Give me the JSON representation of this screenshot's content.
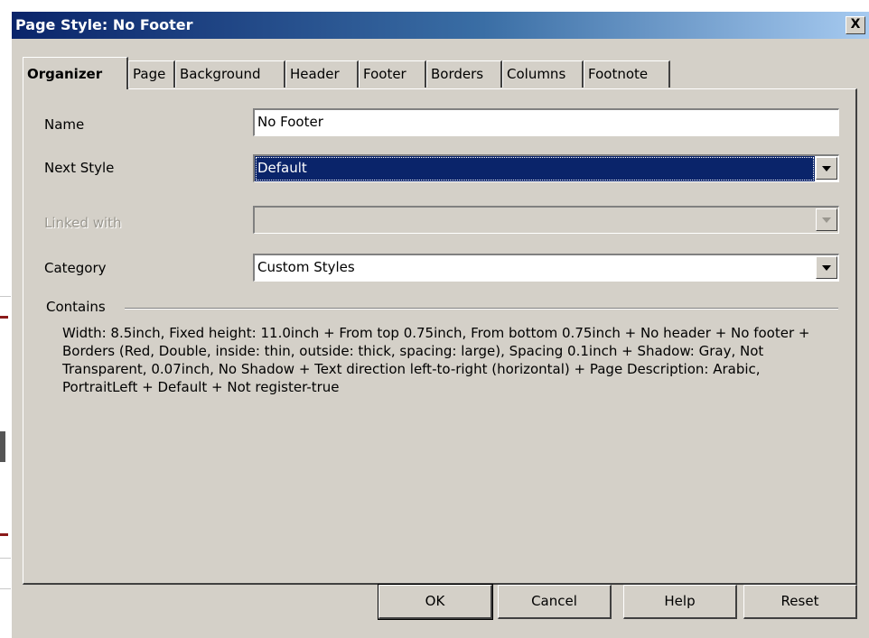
{
  "window": {
    "title": "Page Style: No Footer",
    "close_label": "X"
  },
  "tabs": [
    {
      "label": "Organizer",
      "active": true
    },
    {
      "label": "Page"
    },
    {
      "label": "Background"
    },
    {
      "label": "Header"
    },
    {
      "label": "Footer"
    },
    {
      "label": "Borders"
    },
    {
      "label": "Columns"
    },
    {
      "label": "Footnote"
    }
  ],
  "organizer": {
    "name": {
      "label": "Name",
      "value": "No Footer"
    },
    "next_style": {
      "label": "Next Style",
      "value": "Default"
    },
    "linked_with": {
      "label": "Linked with",
      "value": "",
      "disabled": true
    },
    "category": {
      "label": "Category",
      "value": "Custom Styles"
    },
    "contains": {
      "label": "Contains",
      "text": "Width: 8.5inch, Fixed height: 11.0inch + From top 0.75inch, From bottom 0.75inch + No header + No footer + Borders (Red, Double, inside: thin, outside: thick, spacing: large), Spacing 0.1inch + Shadow: Gray, Not Transparent, 0.07inch, No Shadow + Text direction left-to-right (horizontal) + Page Description: Arabic, PortraitLeft + Default + Not register-true"
    }
  },
  "buttons": {
    "ok": "OK",
    "cancel": "Cancel",
    "help": "Help",
    "reset": "Reset"
  },
  "colors": {
    "titlebar_start": "#0a246a",
    "titlebar_end": "#a6caf0",
    "dialog_face": "#d4d0c8",
    "selection": "#0a246a"
  }
}
